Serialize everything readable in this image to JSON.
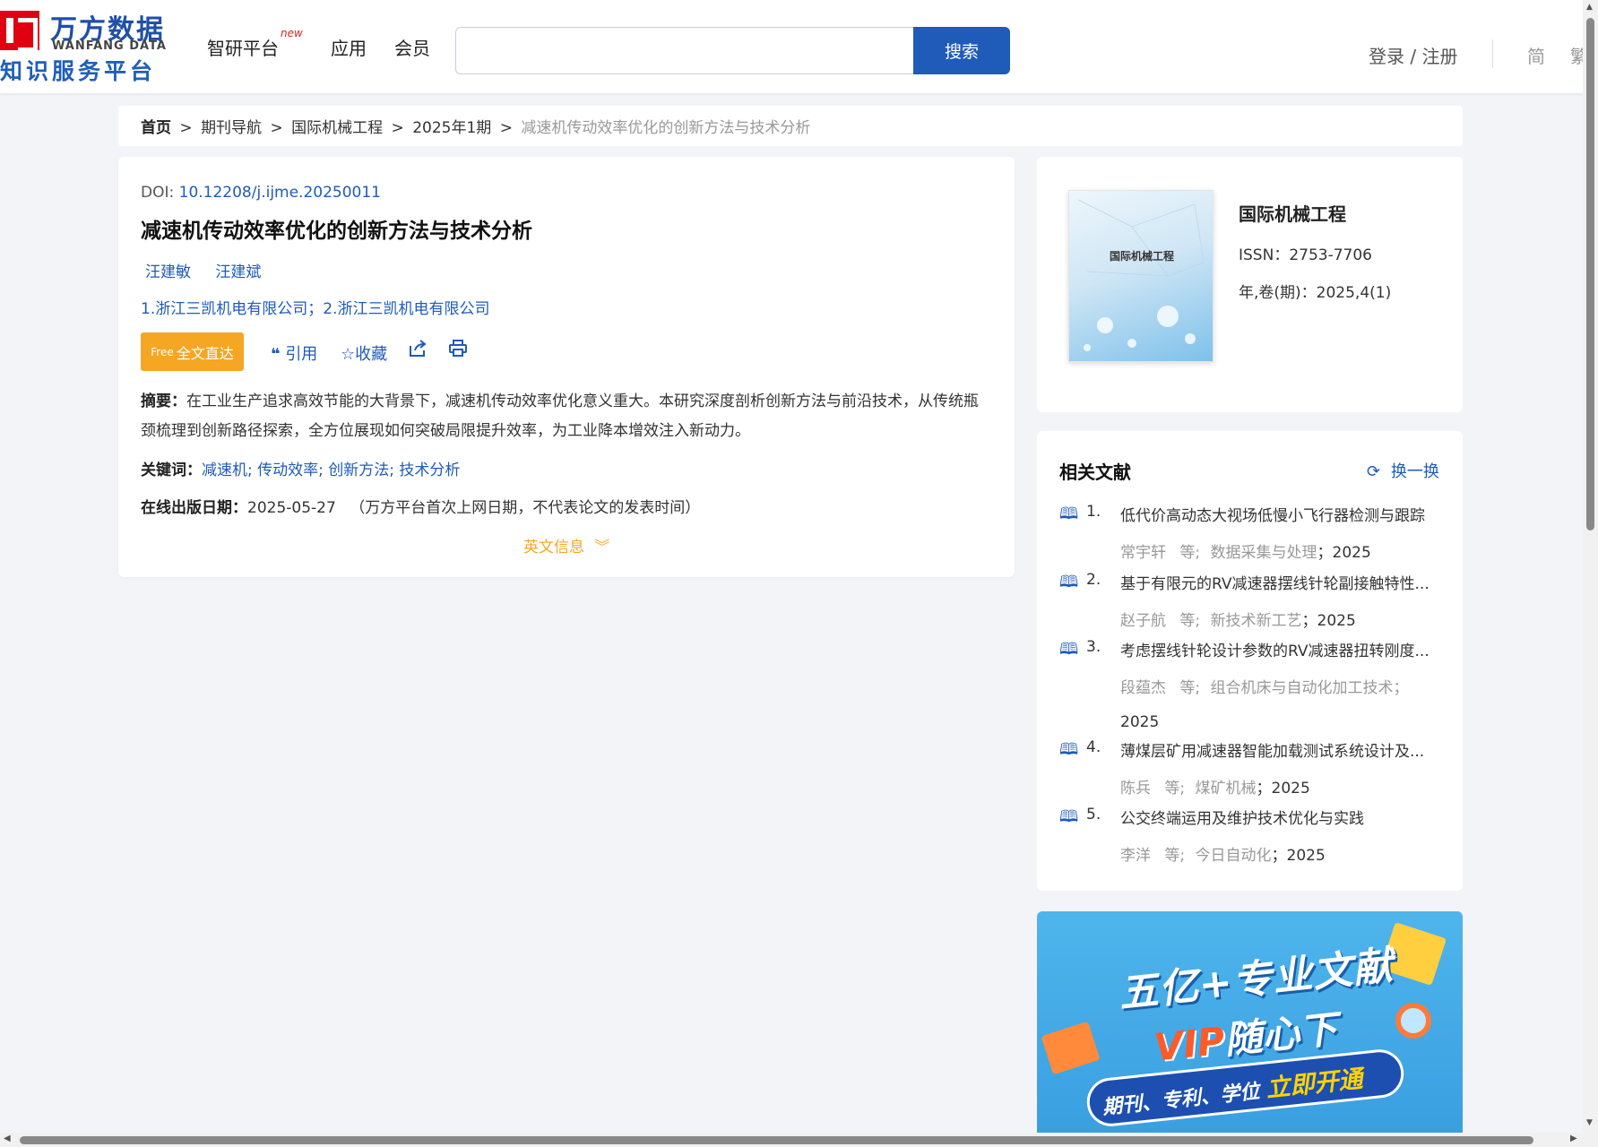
{
  "header": {
    "logo_cn": "万方数据",
    "logo_en": "WANFANG DATA",
    "logo_sub": "知识服务平台",
    "nav": [
      {
        "label": "智研平台",
        "badge": "new"
      },
      {
        "label": "应用"
      },
      {
        "label": "会员"
      }
    ],
    "search_placeholder": "",
    "search_button": "搜索",
    "login": "登录 / 注册",
    "lang_simplified": "简",
    "lang_traditional": "繁"
  },
  "breadcrumb": {
    "home": "首页",
    "items": [
      "期刊导航",
      "国际机械工程",
      "2025年1期"
    ],
    "current": "减速机传动效率优化的创新方法与技术分析",
    "separator": ">"
  },
  "article": {
    "doi_label": "DOI:",
    "doi": "10.12208/j.ijme.20250011",
    "title": "减速机传动效率优化的创新方法与技术分析",
    "authors": [
      "汪建敏",
      "汪建斌"
    ],
    "affiliation": "1.浙江三凯机电有限公司；2.浙江三凯机电有限公司",
    "fulltext_button": "全文直达",
    "fulltext_icon_text": "Free",
    "actions": {
      "cite": "引用",
      "favorite": "收藏"
    },
    "abstract_label": "摘要：",
    "abstract": "在工业生产追求高效节能的大背景下，减速机传动效率优化意义重大。本研究深度剖析创新方法与前沿技术，从传统瓶颈梳理到创新路径探索，全方位展现如何突破局限提升效率，为工业降本增效注入新动力。",
    "keywords_label": "关键词：",
    "keywords": [
      "减速机",
      "传动效率",
      "创新方法",
      "技术分析"
    ],
    "pubdate_label": "在线出版日期：",
    "pubdate": "2025-05-27",
    "pubdate_note": "（万方平台首次上网日期，不代表论文的发表时间）",
    "english_info": "英文信息"
  },
  "journal": {
    "cover_title": "国际机械工程",
    "name": "国际机械工程",
    "issn_label": "ISSN：",
    "issn": "2753-7706",
    "volume_label": "年,卷(期)：",
    "volume": "2025,4(1)"
  },
  "related": {
    "heading": "相关文献",
    "refresh": "换一换",
    "items": [
      {
        "no": "1.",
        "title": "低代价高动态大视场低慢小飞行器检测与跟踪",
        "authors": "常宇轩",
        "etal": "等;",
        "source": "数据采集与处理",
        "year": "2025"
      },
      {
        "no": "2.",
        "title": "基于有限元的RV减速器摆线针轮副接触特性...",
        "authors": "赵子航",
        "etal": "等;",
        "source": "新技术新工艺",
        "year": "2025"
      },
      {
        "no": "3.",
        "title": "考虑摆线针轮设计参数的RV减速器扭转刚度...",
        "authors": "段蕴杰",
        "etal": "等;",
        "source": "组合机床与自动化加工技术",
        "year": "2025"
      },
      {
        "no": "4.",
        "title": "薄煤层矿用减速器智能加载测试系统设计及...",
        "authors": "陈兵",
        "etal": "等;",
        "source": "煤矿机械",
        "year": "2025"
      },
      {
        "no": "5.",
        "title": "公交终端运用及维护技术优化与实践",
        "authors": "李洋",
        "etal": "等;",
        "source": "今日自动化",
        "year": "2025"
      }
    ]
  },
  "ad": {
    "line1": "五亿+专业文献",
    "vip": "VIP",
    "line2_rest": "随心下",
    "pill_text": "期刊、专利、学位",
    "pill_highlight": "立即开通"
  },
  "colors": {
    "brand_blue": "#1f5bb8",
    "accent_orange": "#f5a623",
    "logo_red": "#e00012"
  }
}
